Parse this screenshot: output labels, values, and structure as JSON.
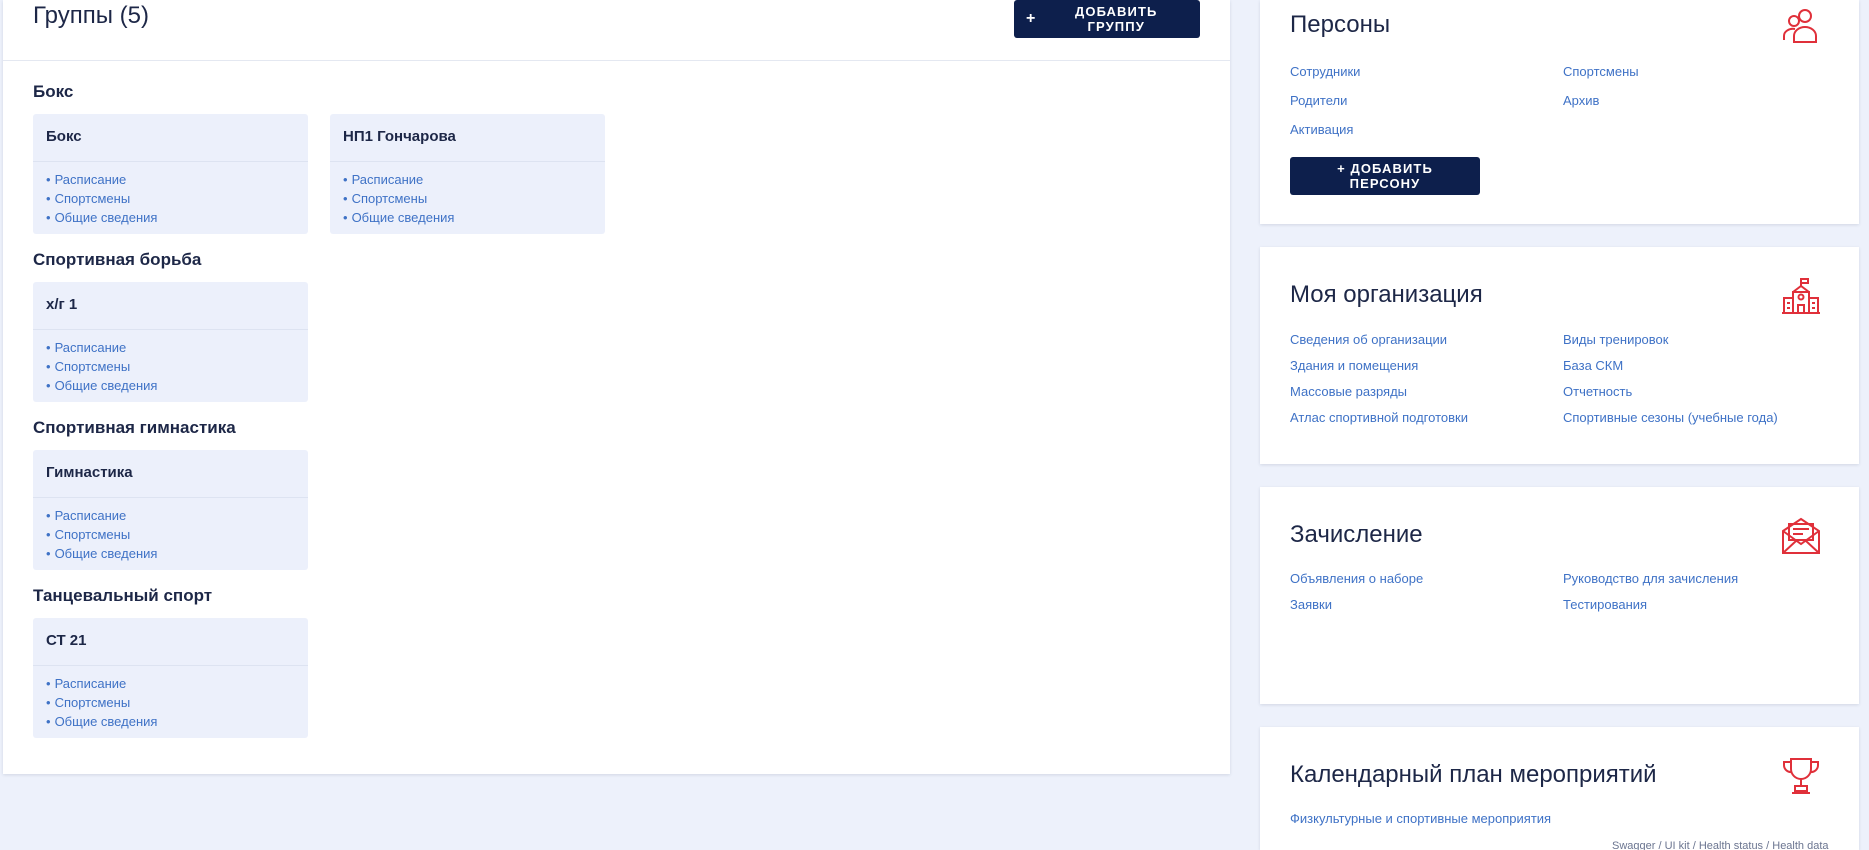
{
  "groups": {
    "title": "Группы (5)",
    "add_button": "ДОБАВИТЬ ГРУППУ",
    "plus": "+",
    "dot": "•",
    "sections": [
      {
        "sport": "Бокс",
        "cards": [
          {
            "name": "Бокс",
            "links": [
              "Расписание",
              "Спортсмены",
              "Общие сведения"
            ]
          },
          {
            "name": "НП1 Гончарова",
            "links": [
              "Расписание",
              "Спортсмены",
              "Общие сведения"
            ]
          }
        ]
      },
      {
        "sport": "Спортивная борьба",
        "cards": [
          {
            "name": "х/г 1",
            "links": [
              "Расписание",
              "Спортсмены",
              "Общие сведения"
            ]
          }
        ]
      },
      {
        "sport": "Спортивная гимнастика",
        "cards": [
          {
            "name": "Гимнастика",
            "links": [
              "Расписание",
              "Спортсмены",
              "Общие сведения"
            ]
          }
        ]
      },
      {
        "sport": "Танцевальный спорт",
        "cards": [
          {
            "name": "СТ 21",
            "links": [
              "Расписание",
              "Спортсмены",
              "Общие сведения"
            ]
          }
        ]
      }
    ]
  },
  "persons": {
    "title": "Персоны",
    "icon": "people-icon",
    "links": [
      "Сотрудники",
      "Спортсмены",
      "Родители",
      "Архив",
      "Активация"
    ],
    "add_button": "+ ДОБАВИТЬ ПЕРСОНУ"
  },
  "organization": {
    "title": "Моя организация",
    "icon": "school-building-icon",
    "links": [
      "Сведения об организации",
      "Виды тренировок",
      "Здания и помещения",
      "База СКМ",
      "Массовые разряды",
      "Отчетность",
      "Атлас спортивной подготовки",
      "Спортивные сезоны (учебные года)"
    ]
  },
  "enrollment": {
    "title": "Зачисление",
    "icon": "envelope-icon",
    "links": [
      "Объявления о наборе",
      "Руководство для зачисления",
      "Заявки",
      "Тестирования"
    ]
  },
  "calendar": {
    "title": "Календарный план мероприятий",
    "icon": "trophy-icon",
    "links": [
      "Физкультурные и спортивные мероприятия"
    ]
  },
  "footer": {
    "links": [
      "Swagger",
      "UI kit",
      "Health status",
      "Health data"
    ],
    "separator": "/"
  },
  "colors": {
    "accent_dark": "#0d1f4c",
    "link": "#3f72c6",
    "icon_red": "#e0303a",
    "background": "#edf1fb"
  }
}
